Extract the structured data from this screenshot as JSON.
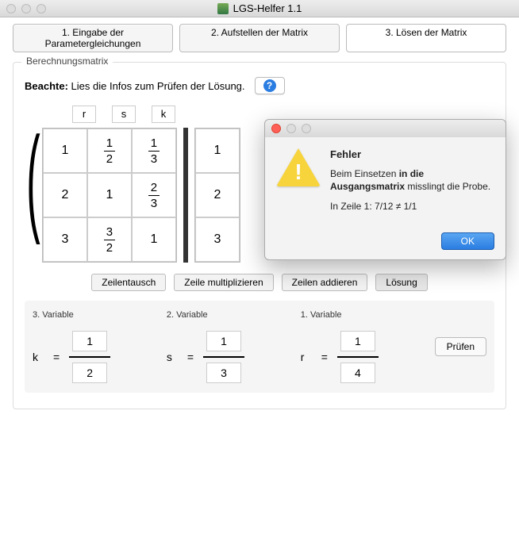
{
  "window": {
    "title": "LGS-Helfer 1.1"
  },
  "tabs": [
    {
      "label": "1. Eingabe der Parametergleichungen"
    },
    {
      "label": "2. Aufstellen der Matrix"
    },
    {
      "label": "3. Lösen der Matrix"
    }
  ],
  "groupbox_title": "Berechnungsmatrix",
  "note": {
    "bold": "Beachte:",
    "text": "Lies die Infos zum Prüfen der Lösung."
  },
  "col_labels": [
    "r",
    "s",
    "k"
  ],
  "matrix_left": [
    [
      "1",
      "1/2",
      "1/3"
    ],
    [
      "2",
      "1",
      "2/3"
    ],
    [
      "3",
      "3/2",
      "1"
    ]
  ],
  "matrix_right_col": [
    "1",
    "2",
    "3"
  ],
  "subtabs": [
    "Zeilentausch",
    "Zeile multiplizieren",
    "Zeilen addieren",
    "Lösung"
  ],
  "variables": [
    {
      "title": "3. Variable",
      "name": "k",
      "num": "1",
      "den": "2"
    },
    {
      "title": "2. Variable",
      "name": "s",
      "num": "1",
      "den": "3"
    },
    {
      "title": "1. Variable",
      "name": "r",
      "num": "1",
      "den": "4"
    }
  ],
  "pruefen": "Prüfen",
  "dialog": {
    "title": "Fehler",
    "line1a": "Beim Einsetzen ",
    "line1b": "in die Ausgangsmatrix",
    "line1c": " misslingt die Probe.",
    "line2": "In Zeile 1: 7/12 ≠ 1/1",
    "ok": "OK"
  }
}
